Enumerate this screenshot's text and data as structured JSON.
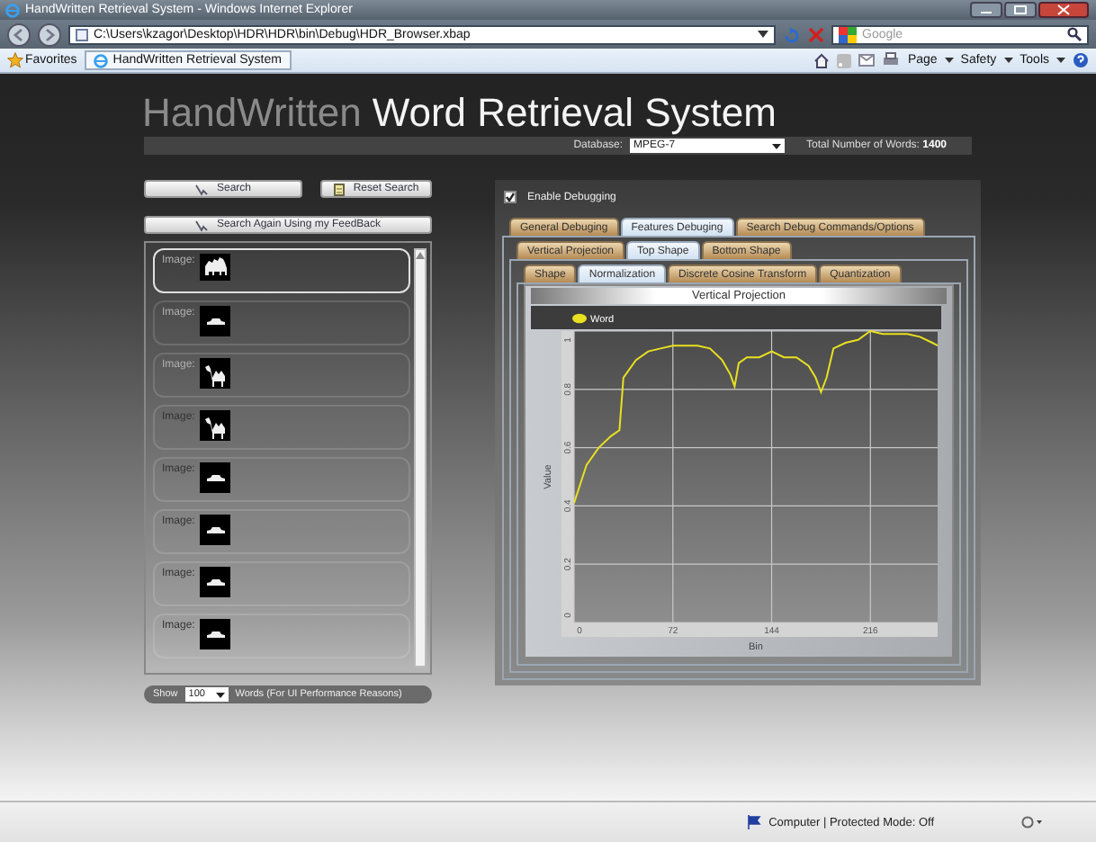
{
  "browser": {
    "title": "HandWritten Retrieval System - Windows Internet Explorer",
    "address": "C:\\Users\\kzagor\\Desktop\\HDR\\HDR\\bin\\Debug\\HDR_Browser.xbap",
    "search": {
      "placeholder": "Google"
    },
    "favorites_label": "Favorites",
    "tab": "HandWritten Retrieval System",
    "commands": [
      "Page",
      "Safety",
      "Tools"
    ]
  },
  "app": {
    "title_light": "HandWritten",
    "title_bold": "Word Retrieval System"
  },
  "header_bar": {
    "database_label": "Database:",
    "database_value": "MPEG-7",
    "total": "Total Number of Words: **1400**"
  },
  "left_panel": {
    "buttons": [
      {
        "kind": "search",
        "label": "Search"
      },
      {
        "kind": "reset",
        "label": "Reset Search"
      }
    ],
    "feedback_button": "Search Again Using my FeedBack",
    "results": [
      {
        "label": "Image:",
        "kind": "camel_group",
        "selected": true
      },
      {
        "label": "Image:",
        "kind": "car",
        "selected": false
      },
      {
        "label": "Image:",
        "kind": "camel",
        "selected": false
      },
      {
        "label": "Image:",
        "kind": "camel",
        "selected": false
      },
      {
        "label": "Image:",
        "kind": "car",
        "selected": false
      },
      {
        "label": "Image:",
        "kind": "car",
        "selected": false
      },
      {
        "label": "Image:",
        "kind": "car",
        "selected": false
      },
      {
        "label": "Image:",
        "kind": "car",
        "selected": false
      }
    ],
    "show_label": "Show",
    "show_value": "100",
    "show_suffix": "Words (For UI Performance Reasons)"
  },
  "debug_panel": {
    "enable_debugging": {
      "label": "Enable Debugging",
      "checked": true
    },
    "tabs": [
      {
        "label": "General Debuging",
        "selected": false
      },
      {
        "label": "Features Debuging",
        "selected": true
      },
      {
        "label": "Search Debug Commands/Options",
        "selected": false
      }
    ],
    "subtabs": [
      {
        "label": "Vertical Projection",
        "selected": false
      },
      {
        "label": "Top Shape",
        "selected": true
      },
      {
        "label": "Bottom Shape",
        "selected": false
      }
    ],
    "feature_tabs": [
      {
        "label": "Shape",
        "selected": false
      },
      {
        "label": "Normalization",
        "selected": true
      },
      {
        "label": "Discrete Cosine Transform",
        "selected": false
      },
      {
        "label": "Quantization",
        "selected": false
      }
    ],
    "chart": {
      "chart_data": {
        "type": "line",
        "title": "Vertical Projection",
        "xlabel": "Bin",
        "ylabel": "Value",
        "x": [
          0,
          9,
          18,
          27,
          33,
          36,
          45,
          54,
          63,
          72,
          90,
          99,
          108,
          114,
          117,
          120,
          126,
          135,
          144,
          153,
          162,
          171,
          176,
          180,
          184,
          189,
          198,
          207,
          216,
          225,
          243,
          252,
          261,
          265
        ],
        "series": [
          {
            "name": "Word",
            "color": "#e8e020",
            "values": [
              0.41,
              0.54,
              0.6,
              0.64,
              0.66,
              0.84,
              0.9,
              0.93,
              0.94,
              0.95,
              0.95,
              0.94,
              0.9,
              0.85,
              0.81,
              0.89,
              0.91,
              0.91,
              0.93,
              0.91,
              0.91,
              0.88,
              0.84,
              0.79,
              0.84,
              0.94,
              0.96,
              0.97,
              1.0,
              0.99,
              0.99,
              0.98,
              0.96,
              0.95
            ]
          }
        ],
        "grid": true,
        "xlim": [
          0,
          265
        ],
        "ylim": [
          0,
          1
        ],
        "xticks": [
          0,
          72,
          144,
          216
        ],
        "yticks": [
          0,
          0.2,
          0.4,
          0.6,
          0.8,
          1
        ]
      }
    }
  },
  "status_bar": {
    "zone": "Computer | Protected Mode: Off"
  }
}
